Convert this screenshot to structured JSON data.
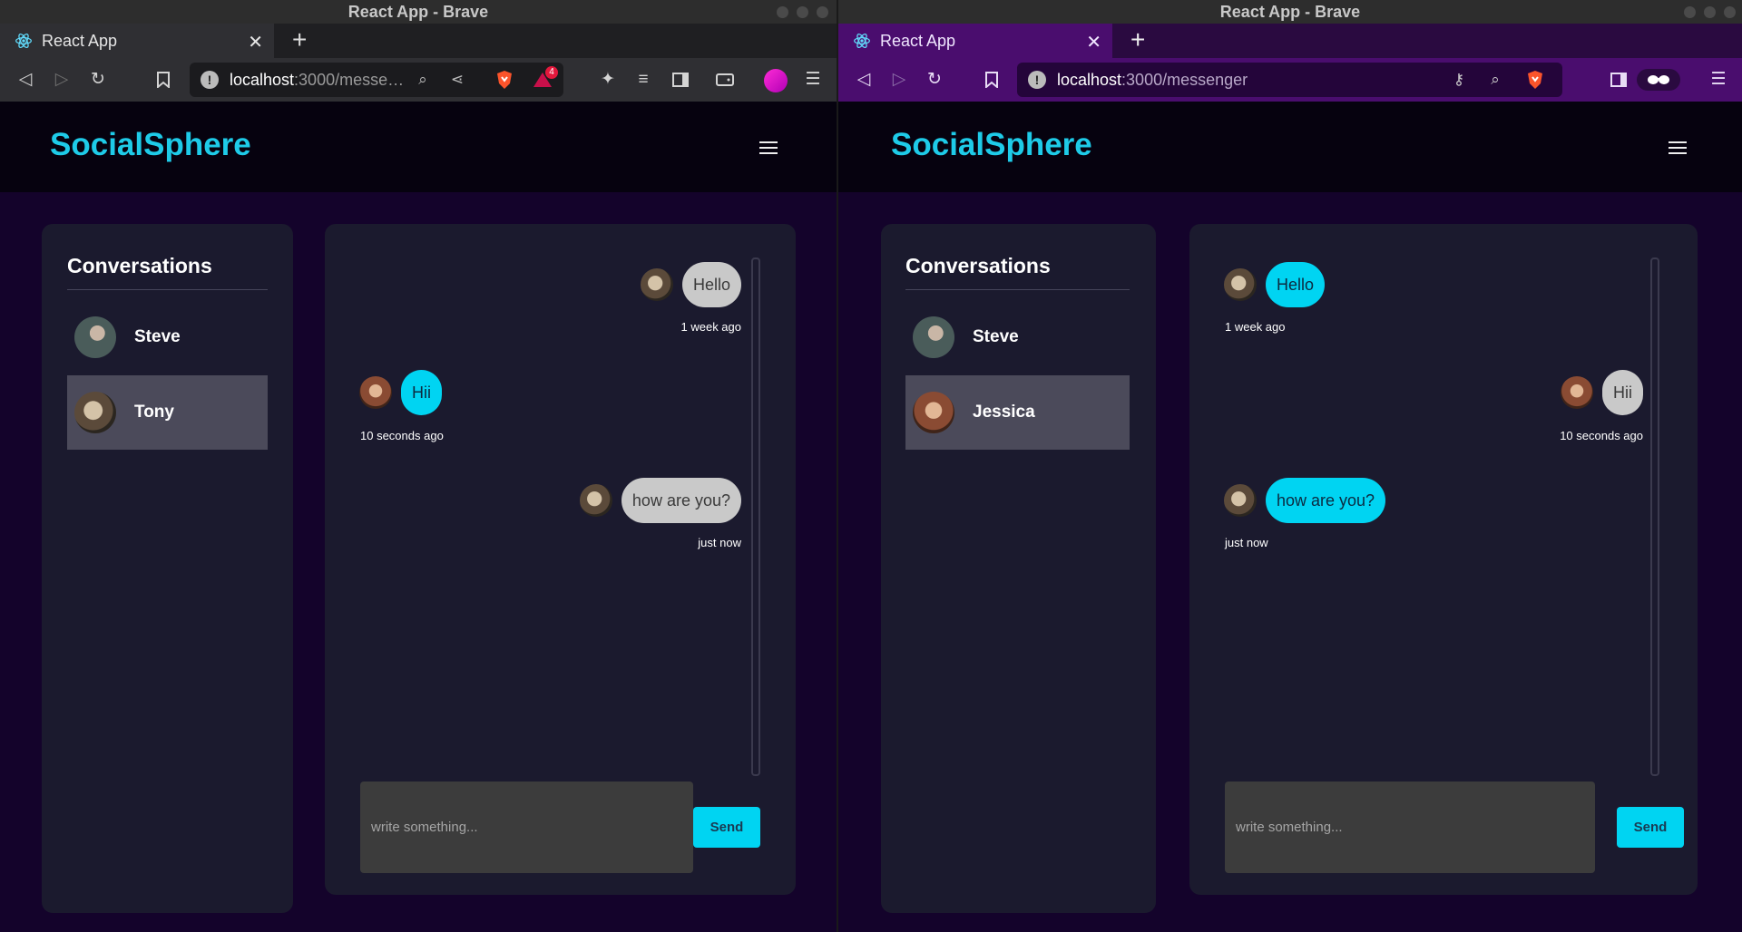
{
  "windows": [
    {
      "title": "React App - Brave",
      "tab_title": "React App",
      "url_host": "localhost",
      "url_rest": ":3000/messe…",
      "badge_count": "4",
      "page": {
        "logo": "SocialSphere",
        "conversations_title": "Conversations",
        "conversations": [
          {
            "name": "Steve",
            "active": false
          },
          {
            "name": "Tony",
            "active": true
          }
        ],
        "messages": [
          {
            "text": "Hello",
            "time": "1 week ago",
            "own": true
          },
          {
            "text": "Hii",
            "time": "10 seconds ago",
            "own": false
          },
          {
            "text": "how are you?",
            "time": "just now",
            "own": true
          }
        ],
        "input_placeholder": "write something...",
        "send_label": "Send"
      }
    },
    {
      "title": "React App - Brave",
      "tab_title": "React App",
      "url_host": "localhost",
      "url_rest": ":3000/messenger",
      "page": {
        "logo": "SocialSphere",
        "conversations_title": "Conversations",
        "conversations": [
          {
            "name": "Steve",
            "active": false
          },
          {
            "name": "Jessica",
            "active": true
          }
        ],
        "messages": [
          {
            "text": "Hello",
            "time": "1 week ago",
            "own": false
          },
          {
            "text": "Hii",
            "time": "10 seconds ago",
            "own": true
          },
          {
            "text": "how are you?",
            "time": "just now",
            "own": false
          }
        ],
        "input_placeholder": "write something...",
        "send_label": "Send"
      }
    }
  ],
  "colors": {
    "brand": "#1ecbe8",
    "left_chrome": "#2f2f33",
    "private_chrome": "#4a0d6e",
    "bubble_own": "#c9c9c9",
    "bubble_other": "#00d4f2"
  }
}
